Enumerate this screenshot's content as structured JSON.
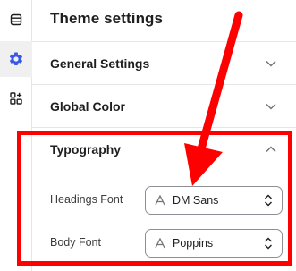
{
  "rail": {
    "items": [
      {
        "icon": "layout-icon",
        "active": false
      },
      {
        "icon": "gear-icon",
        "active": true
      },
      {
        "icon": "blocks-add-icon",
        "active": false
      }
    ]
  },
  "panel": {
    "title": "Theme settings",
    "sections": [
      {
        "label": "General Settings",
        "expanded": false
      },
      {
        "label": "Global Color",
        "expanded": false
      },
      {
        "label": "Typography",
        "expanded": true
      }
    ]
  },
  "typography": {
    "headings_font": {
      "label": "Headings Font",
      "value": "DM Sans"
    },
    "body_font": {
      "label": "Body Font",
      "value": "Poppins"
    }
  },
  "annotation": {
    "color": "#ff0000"
  },
  "colors": {
    "accent": "#3858e9",
    "border": "#e6e6e6"
  }
}
